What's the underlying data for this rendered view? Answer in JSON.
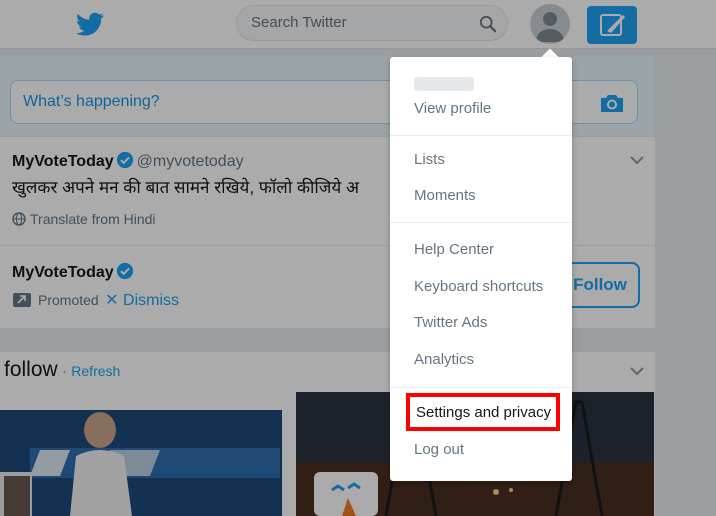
{
  "header": {
    "search_placeholder": "Search Twitter"
  },
  "composer": {
    "placeholder": "What’s happening?"
  },
  "tweets": [
    {
      "name": "MyVoteToday",
      "handle": "@myvotetoday",
      "text": "खुलकर अपने मन की बात सामने रखिये, फॉलो कीजिये अ",
      "translate": "Translate from Hindi"
    },
    {
      "name": "MyVoteToday",
      "promoted": "Promoted",
      "dismiss": "Dismiss",
      "follow_label": "Follow"
    }
  ],
  "who_to_follow": {
    "title": "follow",
    "separator": "·",
    "refresh": "Refresh"
  },
  "dropdown": {
    "view_profile": "View profile",
    "lists": "Lists",
    "moments": "Moments",
    "help_center": "Help Center",
    "keyboard_shortcuts": "Keyboard shortcuts",
    "twitter_ads": "Twitter Ads",
    "analytics": "Analytics",
    "settings_privacy": "Settings and privacy",
    "log_out": "Log out"
  },
  "colors": {
    "brand": "#1da1f2",
    "highlight": "#ff0000"
  }
}
